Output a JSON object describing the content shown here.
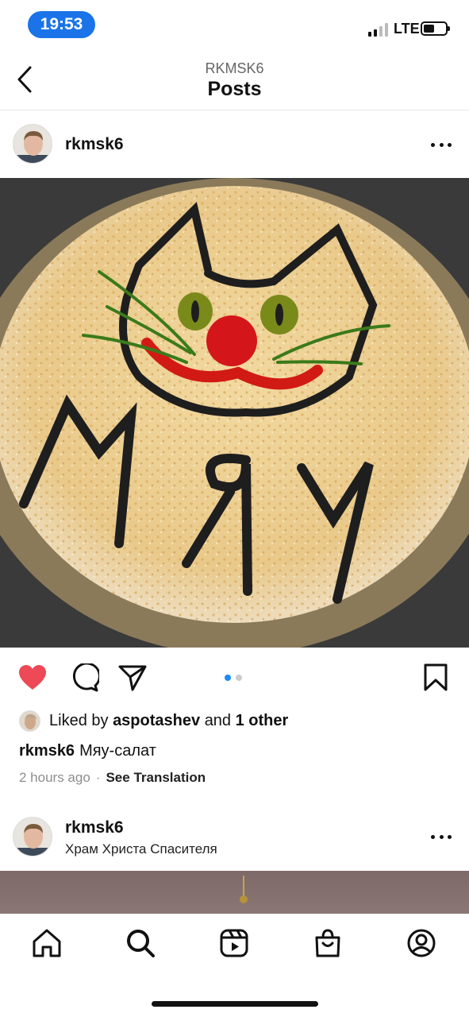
{
  "status_bar": {
    "time": "19:53",
    "network": "LTE"
  },
  "header": {
    "subtitle": "RKMSK6",
    "title": "Posts"
  },
  "post": {
    "username": "rkmsk6",
    "image_text": "Мяу",
    "carousel": {
      "count": 2,
      "active": 1
    },
    "likes": {
      "prefix": "Liked by",
      "user": "aspotashev",
      "and": "and",
      "others": "1 other"
    },
    "caption": {
      "user": "rkmsk6",
      "text": "Мяу-салат"
    },
    "time_ago": "2 hours ago",
    "separator": "·",
    "see_translation": "See Translation",
    "liked": true
  },
  "next_post": {
    "username": "rkmsk6",
    "location": "Храм Христа Спасителя"
  },
  "icons": {
    "back": "chevron-left-icon",
    "more": "more-horizontal-icon",
    "like": "heart-filled-icon",
    "comment": "comment-icon",
    "share": "paper-plane-icon",
    "save": "bookmark-icon",
    "home": "home-icon",
    "search": "search-icon",
    "reels": "reels-icon",
    "shop": "shop-bag-icon",
    "profile": "profile-icon"
  },
  "colors": {
    "like": "#ed4956",
    "accent": "#1d8cf0",
    "time_pill": "#1a73e8"
  }
}
